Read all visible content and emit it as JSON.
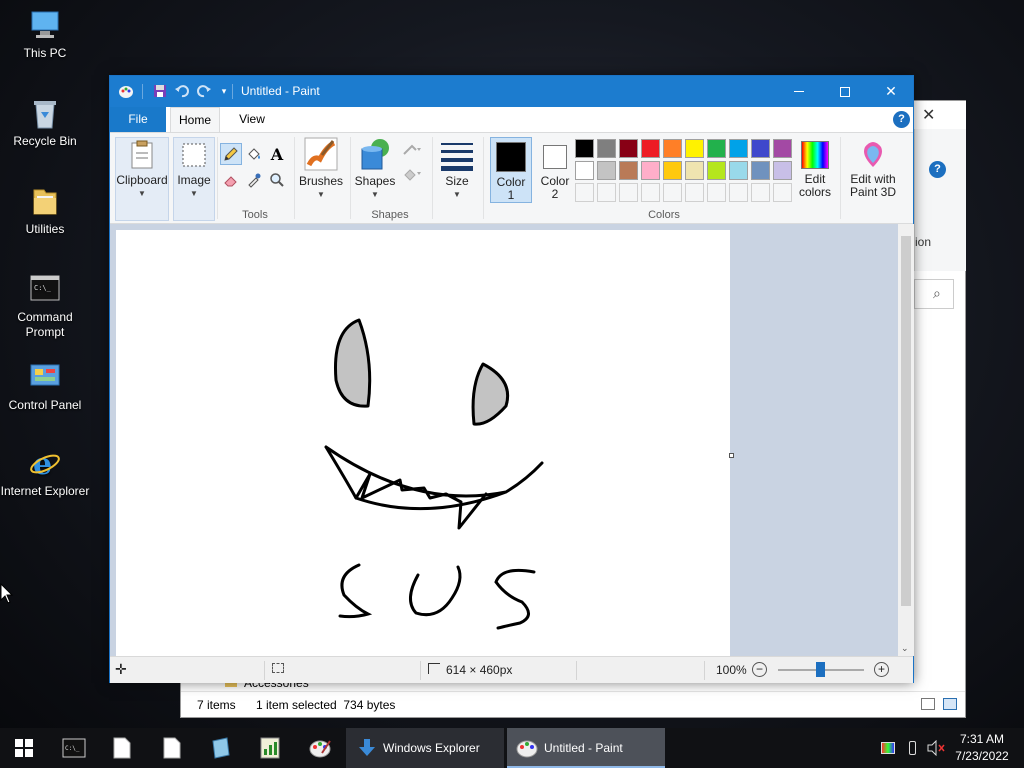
{
  "desktop": {
    "icons": [
      {
        "label": "This PC"
      },
      {
        "label": "Recycle Bin"
      },
      {
        "label": "Utilities"
      },
      {
        "label": "Command Prompt"
      },
      {
        "label": "Control Panel"
      },
      {
        "label": "Internet Explorer"
      }
    ]
  },
  "explorer": {
    "ribbon_partial": "ion",
    "breadcrumb": "Accessories",
    "status": {
      "items": "7 items",
      "selected": "1 item selected  734 bytes"
    }
  },
  "paint": {
    "title": "Untitled - Paint",
    "tabs": {
      "file": "File",
      "home": "Home",
      "view": "View"
    },
    "help_label": "?",
    "ribbon": {
      "clipboard": "Clipboard",
      "image": "Image",
      "tools": "Tools",
      "brushes": "Brushes",
      "shapes_button": "Shapes",
      "shapes_group": "Shapes",
      "size": "Size",
      "color1_line1": "Color",
      "color1_line2": "1",
      "color2_line1": "Color",
      "color2_line2": "2",
      "colors_group": "Colors",
      "edit_colors_line1": "Edit",
      "edit_colors_line2": "colors",
      "paint3d_line1": "Edit with",
      "paint3d_line2": "Paint 3D",
      "text_tool": "A"
    },
    "palette_row1": [
      "#000000",
      "#7f7f7f",
      "#880015",
      "#ed1c24",
      "#ff7f27",
      "#fff200",
      "#22b14c",
      "#00a2e8",
      "#3f48cc",
      "#a349a4"
    ],
    "palette_row2": [
      "#ffffff",
      "#c3c3c3",
      "#b97a57",
      "#ffaec9",
      "#ffc90e",
      "#efe4b0",
      "#b5e61d",
      "#99d9ea",
      "#7092be",
      "#c8bfe7"
    ],
    "statusbar": {
      "dimensions": "614 × 460px",
      "zoom": "100%"
    },
    "drawing_text": "SUS"
  },
  "taskbar": {
    "tasks": [
      {
        "label": "Windows Explorer"
      },
      {
        "label": "Untitled - Paint"
      }
    ],
    "clock": {
      "time": "7:31 AM",
      "date": "7/23/2022"
    }
  }
}
